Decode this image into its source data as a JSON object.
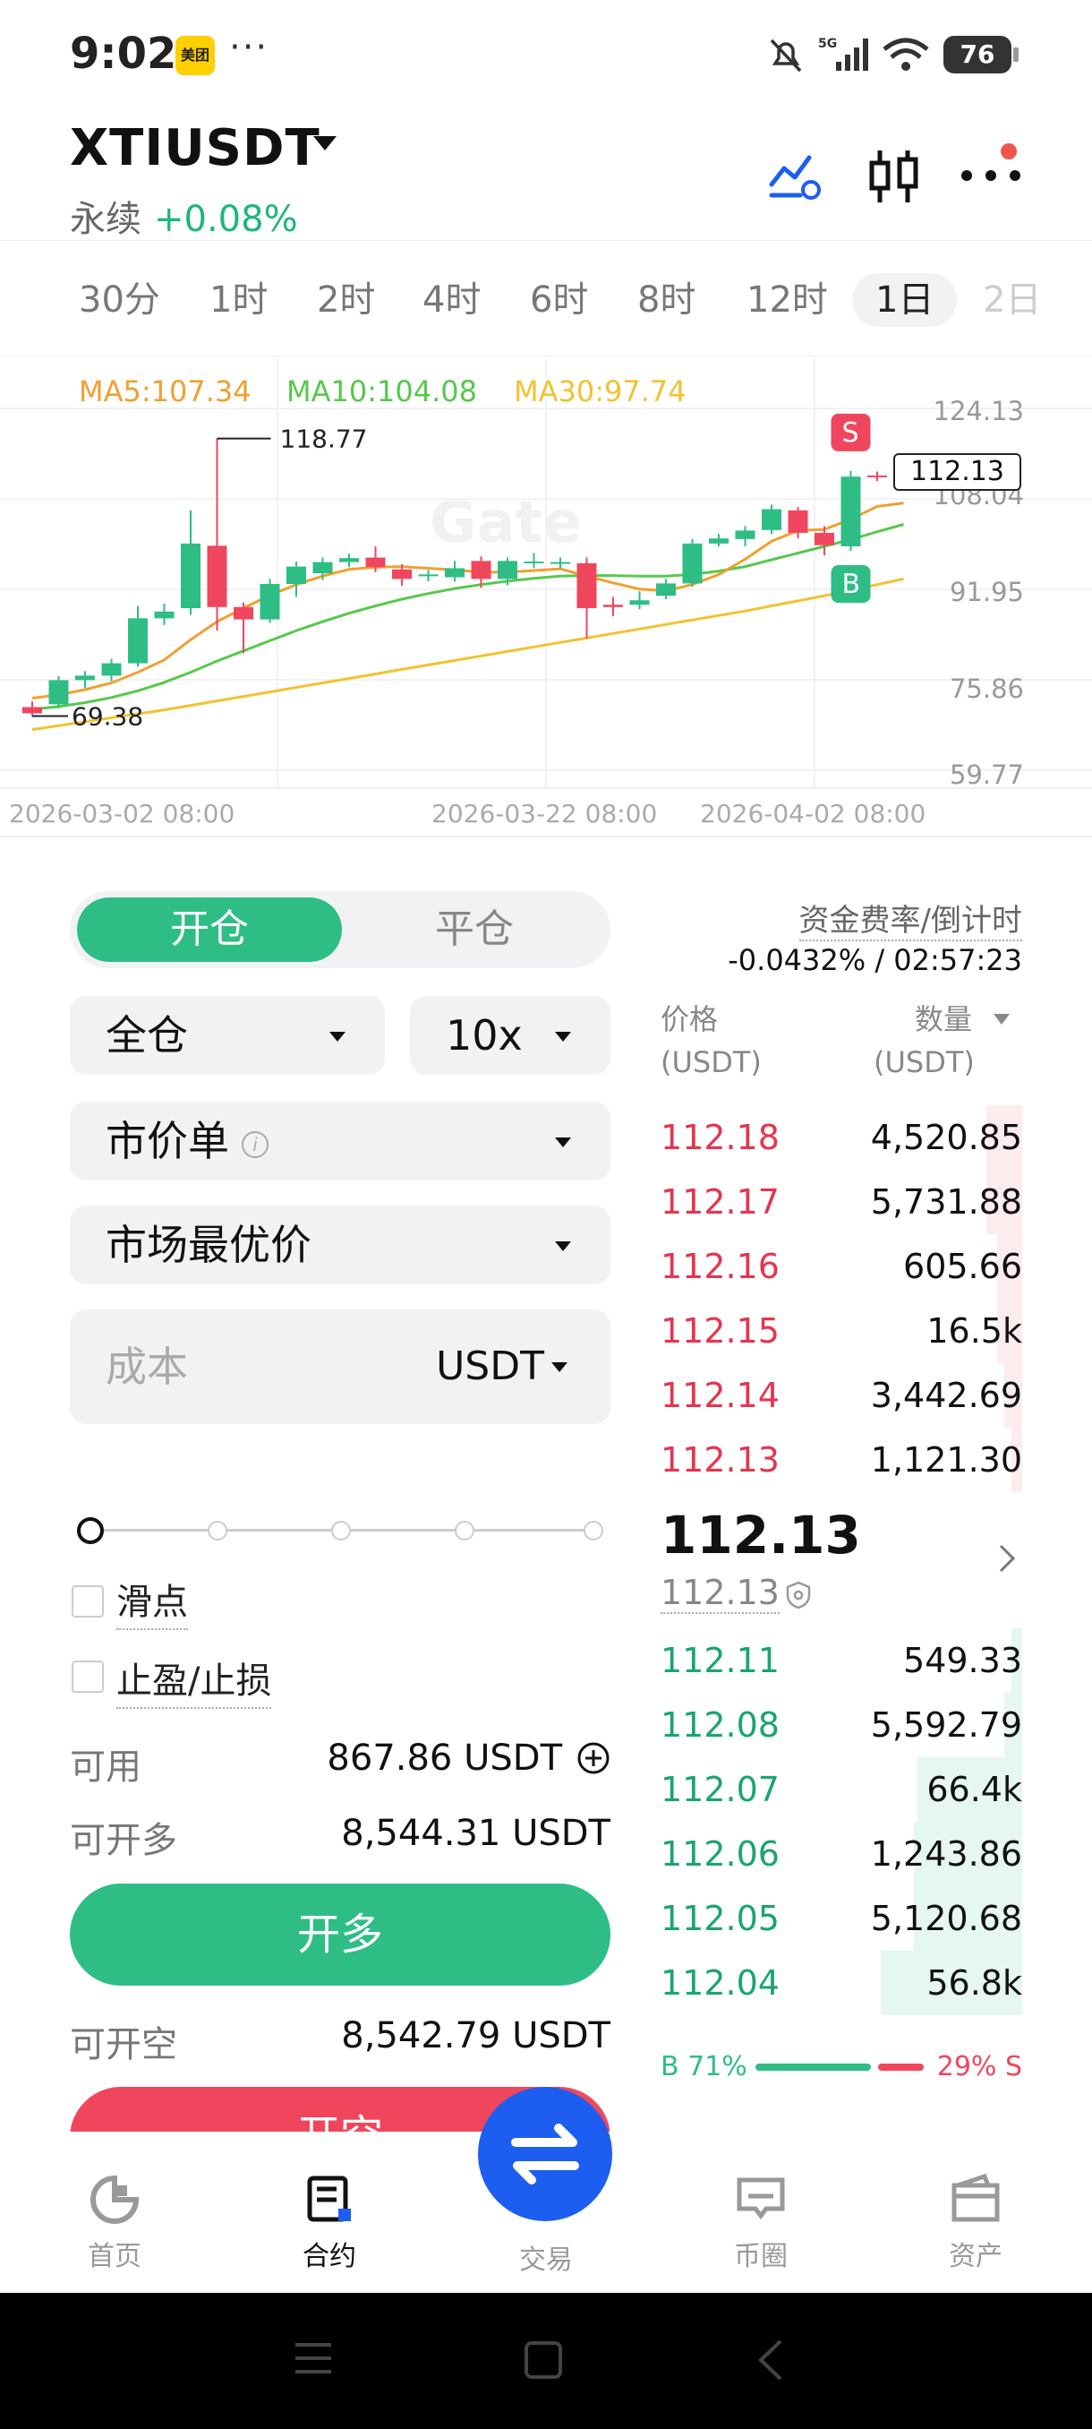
{
  "status_bar": {
    "time": "9:02",
    "app_badge": "美团",
    "more": "···",
    "network": "5G",
    "battery": "76"
  },
  "header": {
    "pair": "XTIUSDT",
    "contract_type": "永续",
    "change": "+0.08%"
  },
  "timeframes": [
    "30分",
    "1时",
    "2时",
    "4时",
    "6时",
    "8时",
    "12时",
    "1日",
    "2日"
  ],
  "active_timeframe": "1日",
  "chart": {
    "watermark": "Gate",
    "ma5": "MA5:107.34",
    "ma10": "MA10:104.08",
    "ma30": "MA30:97.74",
    "colors": {
      "ma5": "#f0a030",
      "ma10": "#57c84d",
      "ma30": "#f2c230",
      "up": "#2ebd85",
      "down": "#f0465d"
    },
    "y_ticks": [
      "124.13",
      "108.04",
      "91.95",
      "75.86",
      "59.77"
    ],
    "x_ticks": [
      "2026-03-02 08:00",
      "2026-03-22 08:00",
      "2026-04-02 08:00"
    ],
    "high_label": "118.77",
    "low_label": "69.38",
    "last_price_tag": "112.13",
    "sell_marker": "S",
    "buy_marker": "B"
  },
  "chart_data": {
    "type": "candlestick",
    "y_range": [
      59.77,
      124.13
    ],
    "candles": [
      {
        "o": 71.0,
        "c": 69.9,
        "h": 72.0,
        "l": 69.4
      },
      {
        "o": 71.5,
        "c": 75.8,
        "h": 76.5,
        "l": 70.8
      },
      {
        "o": 75.8,
        "c": 76.6,
        "h": 77.4,
        "l": 74.4
      },
      {
        "o": 76.6,
        "c": 78.8,
        "h": 79.6,
        "l": 75.6
      },
      {
        "o": 78.8,
        "c": 86.8,
        "h": 89.0,
        "l": 78.2
      },
      {
        "o": 86.8,
        "c": 88.0,
        "h": 89.4,
        "l": 85.6
      },
      {
        "o": 88.6,
        "c": 100.1,
        "h": 106.0,
        "l": 87.4
      },
      {
        "o": 99.7,
        "c": 88.8,
        "h": 118.77,
        "l": 84.6
      },
      {
        "o": 88.8,
        "c": 86.6,
        "h": 89.6,
        "l": 80.6
      },
      {
        "o": 86.6,
        "c": 92.9,
        "h": 93.8,
        "l": 86.0
      },
      {
        "o": 92.9,
        "c": 96.0,
        "h": 96.9,
        "l": 90.6
      },
      {
        "o": 94.8,
        "c": 96.8,
        "h": 97.6,
        "l": 93.6
      },
      {
        "o": 96.8,
        "c": 97.5,
        "h": 98.3,
        "l": 95.9
      },
      {
        "o": 97.6,
        "c": 95.9,
        "h": 99.6,
        "l": 95.0
      },
      {
        "o": 95.5,
        "c": 93.8,
        "h": 96.4,
        "l": 92.6
      },
      {
        "o": 94.4,
        "c": 94.6,
        "h": 95.4,
        "l": 93.4
      },
      {
        "o": 94.1,
        "c": 95.7,
        "h": 97.0,
        "l": 93.3
      },
      {
        "o": 97.0,
        "c": 93.8,
        "h": 97.8,
        "l": 92.2
      },
      {
        "o": 93.8,
        "c": 97.0,
        "h": 97.6,
        "l": 92.7
      },
      {
        "o": 96.6,
        "c": 96.9,
        "h": 98.4,
        "l": 95.7
      },
      {
        "o": 96.6,
        "c": 96.8,
        "h": 97.6,
        "l": 95.7
      },
      {
        "o": 96.6,
        "c": 88.6,
        "h": 97.6,
        "l": 83.2
      },
      {
        "o": 89.2,
        "c": 88.8,
        "h": 90.6,
        "l": 87.2
      },
      {
        "o": 89.2,
        "c": 90.0,
        "h": 91.6,
        "l": 88.4
      },
      {
        "o": 90.8,
        "c": 93.0,
        "h": 93.8,
        "l": 90.2
      },
      {
        "o": 93.0,
        "c": 100.1,
        "h": 100.9,
        "l": 92.4
      },
      {
        "o": 100.1,
        "c": 101.0,
        "h": 101.8,
        "l": 99.6
      },
      {
        "o": 100.9,
        "c": 102.4,
        "h": 103.2,
        "l": 99.6
      },
      {
        "o": 102.5,
        "c": 106.2,
        "h": 107.0,
        "l": 101.8
      },
      {
        "o": 106.0,
        "c": 102.0,
        "h": 106.6,
        "l": 101.0
      },
      {
        "o": 102.0,
        "c": 99.8,
        "h": 103.2,
        "l": 98.0
      },
      {
        "o": 99.6,
        "c": 112.0,
        "h": 113.0,
        "l": 98.8
      },
      {
        "o": 112.2,
        "c": 112.1,
        "h": 112.9,
        "l": 111.2
      },
      {
        "o": 112.1,
        "c": 112.13,
        "h": 112.5,
        "l": 111.8
      }
    ],
    "ma5": [
      72.6,
      73.2,
      74.1,
      75.3,
      77.2,
      79.4,
      83.0,
      86.2,
      88.6,
      90.9,
      92.8,
      94.3,
      95.5,
      95.9,
      96.0,
      95.7,
      95.4,
      95.0,
      95.0,
      95.3,
      95.6,
      94.3,
      93.1,
      92.0,
      91.7,
      92.8,
      94.6,
      97.3,
      100.5,
      102.4,
      102.6,
      104.4,
      106.7,
      107.3
    ],
    "ma10": [
      70.6,
      71.1,
      71.8,
      72.7,
      73.9,
      75.4,
      77.2,
      79.2,
      81.0,
      82.8,
      84.6,
      86.2,
      87.7,
      89.0,
      90.2,
      91.2,
      92.1,
      92.8,
      93.4,
      93.9,
      94.3,
      94.4,
      94.4,
      94.3,
      94.3,
      94.6,
      95.2,
      96.0,
      97.2,
      98.4,
      99.6,
      100.8,
      102.2,
      103.5
    ],
    "ma30": [
      67.0,
      67.7,
      68.4,
      69.1,
      69.8,
      70.5,
      71.3,
      72.1,
      72.9,
      73.7,
      74.5,
      75.3,
      76.1,
      76.9,
      77.7,
      78.5,
      79.3,
      80.1,
      80.9,
      81.7,
      82.5,
      83.3,
      84.1,
      84.9,
      85.7,
      86.5,
      87.3,
      88.1,
      89.0,
      89.9,
      90.8,
      91.8,
      92.8,
      93.8
    ]
  },
  "order_panel": {
    "tab_open": "开仓",
    "tab_close": "平仓",
    "margin_mode": "全仓",
    "leverage": "10x",
    "order_type": "市价单",
    "price_type": "市场最优价",
    "cost_placeholder": "成本",
    "cost_unit": "USDT",
    "slippage": "滑点",
    "tp_sl": "止盈/止损",
    "available_label": "可用",
    "available_value": "867.86 USDT",
    "max_long_label": "可开多",
    "max_long_value": "8,544.31 USDT",
    "btn_long": "开多",
    "max_short_label": "可开空",
    "max_short_value": "8,542.79 USDT",
    "btn_short": "开空"
  },
  "order_book": {
    "funding_label": "资金费率/倒计时",
    "funding_value": "-0.0432% / 02:57:23",
    "price_header": "价格",
    "price_unit": "(USDT)",
    "qty_header": "数量",
    "qty_unit": "(USDT)",
    "asks": [
      {
        "price": "112.18",
        "qty": "4,520.85",
        "depth": 0.1
      },
      {
        "price": "112.17",
        "qty": "5,731.88",
        "depth": 0.1
      },
      {
        "price": "112.16",
        "qty": "605.66",
        "depth": 0.07
      },
      {
        "price": "112.15",
        "qty": "16.5k",
        "depth": 0.07
      },
      {
        "price": "112.14",
        "qty": "3,442.69",
        "depth": 0.05
      },
      {
        "price": "112.13",
        "qty": "1,121.30",
        "depth": 0.03
      }
    ],
    "last_price": "112.13",
    "mark_price": "112.13",
    "bids": [
      {
        "price": "112.11",
        "qty": "549.33",
        "depth": 0.03
      },
      {
        "price": "112.08",
        "qty": "5,592.79",
        "depth": 0.05
      },
      {
        "price": "112.07",
        "qty": "66.4k",
        "depth": 0.29
      },
      {
        "price": "112.06",
        "qty": "1,243.86",
        "depth": 0.3
      },
      {
        "price": "112.05",
        "qty": "5,120.68",
        "depth": 0.3
      },
      {
        "price": "112.04",
        "qty": "56.8k",
        "depth": 0.39
      }
    ],
    "buy_ratio": "B 71%",
    "sell_ratio": "29% S",
    "buy_fraction": 0.71
  },
  "nav": {
    "home": "首页",
    "futures": "合约",
    "trade": "交易",
    "community": "币圈",
    "assets": "资产"
  }
}
